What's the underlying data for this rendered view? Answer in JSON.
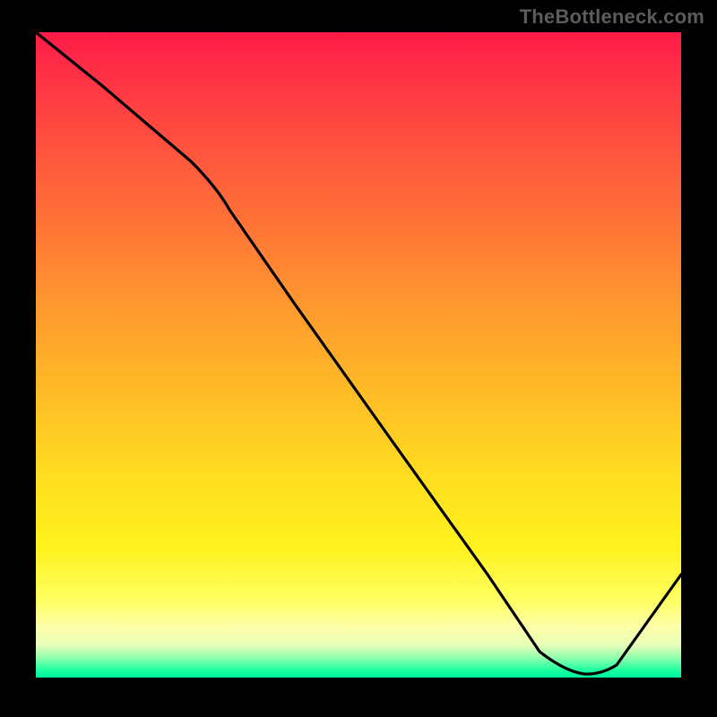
{
  "watermark": "TheBottleneck.com",
  "annotation_text": "",
  "colors": {
    "background": "#000000",
    "curve": "#000000",
    "watermark": "#5c5c5c",
    "annotation": "#d63a00"
  },
  "chart_data": {
    "type": "line",
    "title": "",
    "xlabel": "",
    "ylabel": "",
    "xlim": [
      0,
      100
    ],
    "ylim": [
      0,
      100
    ],
    "grid": false,
    "series": [
      {
        "name": "curve",
        "x": [
          0,
          10,
          24,
          28,
          40,
          55,
          70,
          78,
          82,
          85,
          88,
          100
        ],
        "values": [
          100,
          92,
          80,
          76,
          58,
          37,
          16,
          4,
          1,
          0,
          1,
          16
        ]
      }
    ],
    "annotations": [
      {
        "x": 82,
        "y": 1,
        "text": ""
      }
    ],
    "heatmap_gradient_stops": [
      {
        "y": 100,
        "color": "#ff1a47"
      },
      {
        "y": 80,
        "color": "#ff6a38"
      },
      {
        "y": 60,
        "color": "#ffb028"
      },
      {
        "y": 40,
        "color": "#ffe220"
      },
      {
        "y": 20,
        "color": "#ffff60"
      },
      {
        "y": 8,
        "color": "#ffffa8"
      },
      {
        "y": 3,
        "color": "#8cffad"
      },
      {
        "y": 0,
        "color": "#00eea0"
      }
    ]
  }
}
